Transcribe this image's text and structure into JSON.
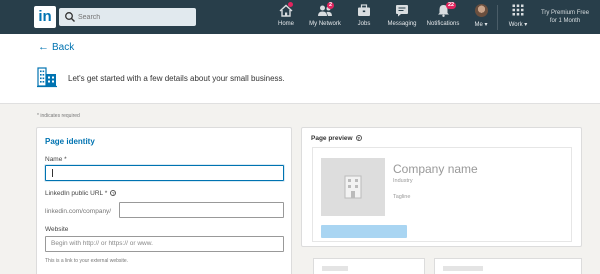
{
  "nav": {
    "logo_text": "in",
    "search_placeholder": "Search",
    "items": [
      {
        "label": "Home",
        "icon": "home-icon",
        "badge": ""
      },
      {
        "label": "My Network",
        "icon": "my-network-icon",
        "badge": "2"
      },
      {
        "label": "Jobs",
        "icon": "jobs-icon",
        "badge": ""
      },
      {
        "label": "Messaging",
        "icon": "messaging-icon",
        "badge": ""
      },
      {
        "label": "Notifications",
        "icon": "notifications-icon",
        "badge": "22"
      },
      {
        "label": "Me ▾",
        "icon": "avatar",
        "badge": ""
      },
      {
        "label": "Work ▾",
        "icon": "work-grid-icon",
        "badge": ""
      }
    ],
    "premium_line1": "Try Premium Free",
    "premium_line2": "for 1 Month"
  },
  "header": {
    "back_label": "Back",
    "intro_text": "Let's get started with a few details about your small business."
  },
  "form": {
    "required_note": "* indicates required",
    "section_title": "Page identity",
    "name_label": "Name *",
    "name_value": "",
    "url_label": "LinkedIn public URL *",
    "url_prefix": "linkedin.com/company/",
    "url_value": "",
    "website_label": "Website",
    "website_placeholder": "Begin with http:// or https:// or www.",
    "website_help": "This is a link to your external website."
  },
  "preview": {
    "title": "Page preview",
    "company_name": "Company name",
    "industry": "Industry",
    "tagline": "Tagline"
  },
  "colors": {
    "nav_bg": "#283e4a",
    "accent": "#0073b1",
    "badge": "#e0245e",
    "follow_bar": "#a9d5f2"
  }
}
